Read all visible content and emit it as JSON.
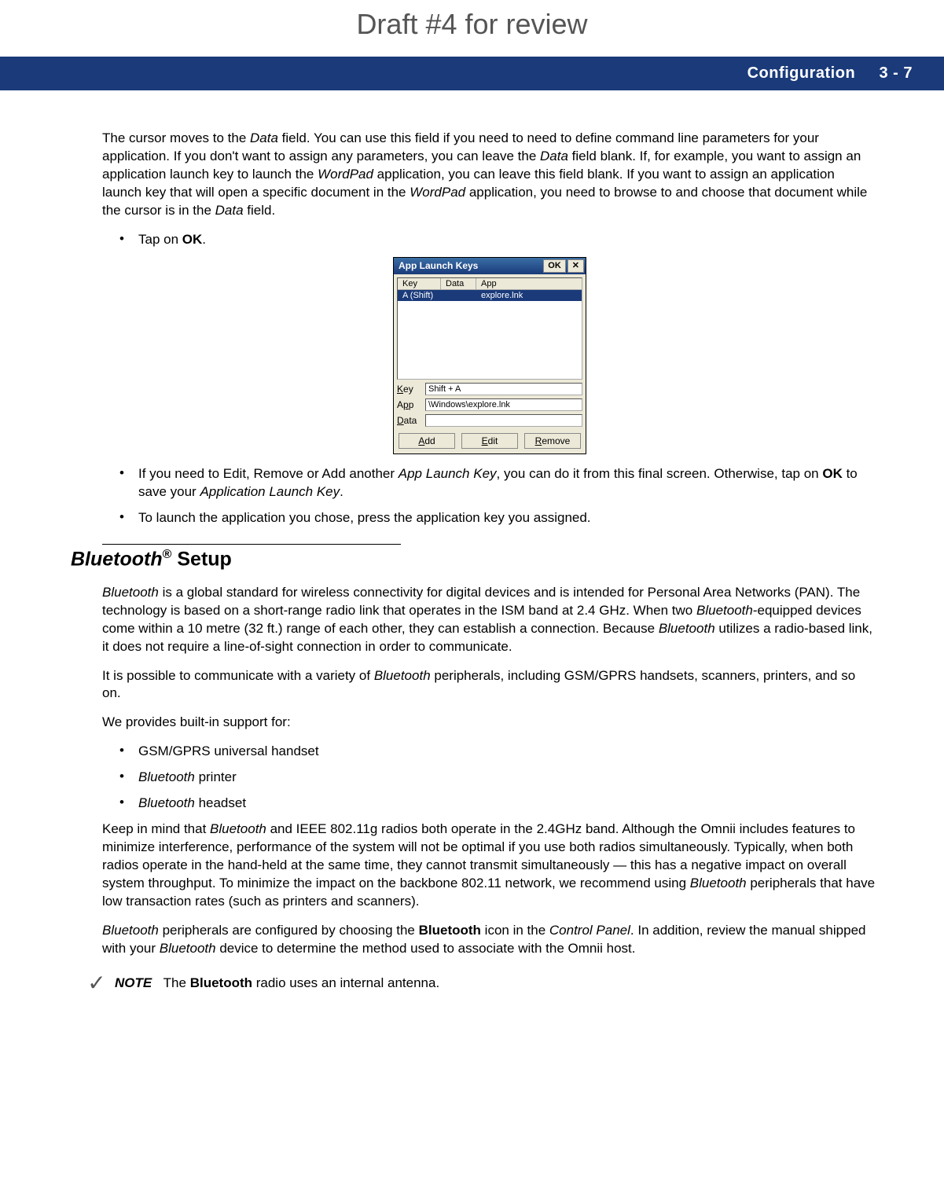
{
  "watermark": "Draft #4 for review",
  "header": {
    "section": "Configuration",
    "page": "3 - 7"
  },
  "para1_parts": {
    "a": "The cursor moves to the ",
    "b": "Data",
    "c": " field. You can use this field if you need to need to define command line parameters for your application. If you don't want to assign any parameters, you can leave the ",
    "d": "Data",
    "e": " field blank. If, for example, you want to assign an application launch key to launch the ",
    "f": "WordPad",
    "g": " application, you can leave this field blank. If you want to assign an application launch key that will open a specific document in the ",
    "h": "WordPad",
    "i": " application, you need to browse to and choose that document while the cursor is in the ",
    "j": "Data",
    "k": " field."
  },
  "bullet_tap": {
    "a": "Tap on ",
    "b": "OK",
    "c": "."
  },
  "dialog": {
    "title": "App Launch Keys",
    "ok": "OK",
    "close": "✕",
    "cols": {
      "key": "Key",
      "data": "Data",
      "app": "App"
    },
    "row": {
      "key": "A (Shift)",
      "data": "",
      "app": "explore.lnk"
    },
    "labels": {
      "key": "Key",
      "app": "App",
      "data": "Data"
    },
    "fields": {
      "key": "Shift + A",
      "app": "\\Windows\\explore.lnk",
      "data": ""
    },
    "buttons": {
      "add": "Add",
      "edit": "Edit",
      "remove": "Remove"
    }
  },
  "bullet_edit": {
    "a": "If you need to Edit, Remove or Add another ",
    "b": "App Launch Key",
    "c": ", you can do it from this final screen. Otherwise, tap on ",
    "d": "OK",
    "e": " to save your ",
    "f": "Application Launch Key",
    "g": "."
  },
  "bullet_launch": "To launch the application you chose, press the application key you assigned.",
  "section_title": {
    "bt": "Bluetooth",
    "reg": "®",
    "rest": " Setup"
  },
  "bt_p1": {
    "a": "Bluetooth",
    "b": " is a global standard for wireless connectivity for digital devices and is intended for Personal Area Networks (PAN). The technology is based on a short-range radio link that operates in the ISM band at 2.4 GHz. When two ",
    "c": "Bluetooth",
    "d": "-equipped devices come within a 10 metre (32 ft.) range of each other, they can establish a connection. Because ",
    "e": "Bluetooth",
    "f": " utilizes a radio-based link, it does not require a line-of-sight connection in order to communicate."
  },
  "bt_p2": {
    "a": "It is possible to communicate with a variety of ",
    "b": "Bluetooth",
    "c": " peripherals, including GSM/GPRS handsets, scanners, printers, and so on."
  },
  "bt_p3": "We provides built-in support for:",
  "bt_list": {
    "i1": "GSM/GPRS universal handset",
    "i2a": "Bluetooth",
    "i2b": " printer",
    "i3a": "Bluetooth",
    "i3b": " headset"
  },
  "bt_p4": {
    "a": "Keep in mind that ",
    "b": "Bluetooth",
    "c": " and IEEE 802.11g radios both operate in the 2.4GHz band. Although the Omnii includes features to minimize interference, performance of the system will not be optimal if you use both radios simultaneously. Typically, when both radios operate in the hand-held at the same time, they cannot transmit simultaneously — this has a negative impact on overall system throughput. To minimize the impact on the backbone 802.11 network, we recommend using ",
    "d": "Bluetooth",
    "e": " peripherals that have low transaction rates (such as printers and scanners)."
  },
  "bt_p5": {
    "a": "Bluetooth",
    "b": " peripherals are configured by choosing the ",
    "c": "Bluetooth",
    "d": " icon in the ",
    "e": "Control Panel",
    "f": ". In addition, review the manual shipped with your ",
    "g": "Bluetooth",
    "h": " device to determine the method used to associate with the Omnii host."
  },
  "note": {
    "label": "NOTE",
    "a": "The ",
    "b": "Bluetooth",
    "c": " radio uses an internal antenna."
  }
}
